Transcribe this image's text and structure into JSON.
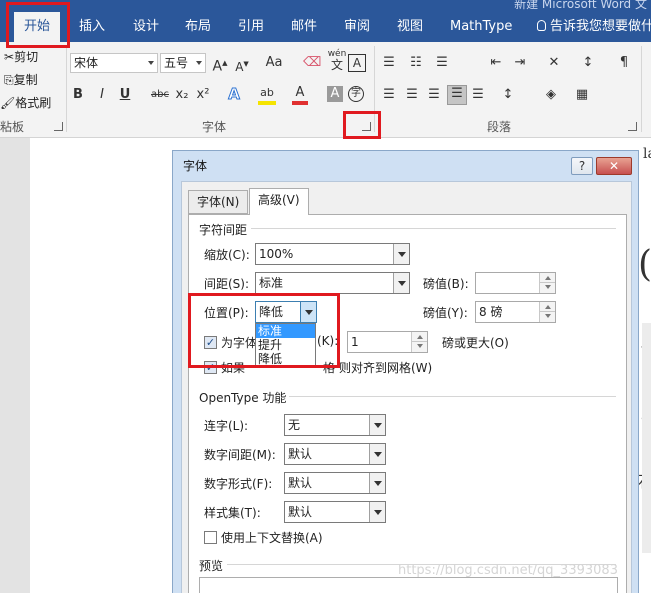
{
  "window": {
    "title_fragment": "新建 Microsoft Word 文"
  },
  "ribbon_tabs": [
    "开始",
    "插入",
    "设计",
    "布局",
    "引用",
    "邮件",
    "审阅",
    "视图",
    "MathType"
  ],
  "tell_me": "告诉我您想要做什",
  "clipboard": {
    "cut": "剪切",
    "copy": "复制",
    "format_painter": "格式刷",
    "group_label": "粘板"
  },
  "font_group": {
    "font_name": "宋体",
    "font_size": "五号",
    "bold": "B",
    "italic": "I",
    "underline": "U",
    "strike": "abc",
    "subscript": "x₂",
    "superscript": "x²",
    "grow": "A",
    "shrink": "A",
    "case": "Aa",
    "phonetic_top": "wén",
    "phonetic_bottom": "文",
    "border_char": "A",
    "enclose": "字",
    "effect": "A",
    "highlight": "ab",
    "font_color": "A",
    "shading": "A",
    "group_label": "字体"
  },
  "paragraph_group": {
    "group_label": "段落"
  },
  "dialog": {
    "title": "字体",
    "help": "?",
    "close": "✕",
    "tabs": [
      "字体(N)",
      "高级(V)"
    ],
    "spacing_section": "字符间距",
    "scale_label": "缩放(C):",
    "scale_value": "100%",
    "spacing_label": "间距(S):",
    "spacing_value": "标准",
    "spacing_by_label": "磅值(B):",
    "spacing_by_value": "",
    "position_label": "位置(P):",
    "position_value": "降低",
    "position_by_label": "磅值(Y):",
    "position_by_value": "8 磅",
    "position_options": [
      "标准",
      "提升",
      "降低"
    ],
    "kerning_label": "为字体",
    "kerning_key": "(K):",
    "kerning_value": "1",
    "kerning_suffix": "磅或更大(O)",
    "grid_prefix": "如果",
    "grid_middle": "格",
    "grid_suffix": "则对齐到网格(W)",
    "opentype_section": "OpenType 功能",
    "ligatures_label": "连字(L):",
    "ligatures_value": "无",
    "num_spacing_label": "数字间距(M):",
    "num_spacing_value": "默认",
    "num_forms_label": "数字形式(F):",
    "num_forms_value": "默认",
    "stylistic_label": "样式集(T):",
    "stylistic_value": "默认",
    "contextual_label": "使用上下文替换(A)",
    "preview_section": "预览"
  },
  "doc_fragments": [
    "la",
    "(",
    "t",
    "a",
    "石"
  ],
  "watermark": "https://blog.csdn.net/qq_3393083",
  "colors": {
    "ribbon_blue": "#2b579a",
    "highlight_red": "#e0191f",
    "font_color_red": "#e03030",
    "highlight_yellow": "#f5e400"
  }
}
